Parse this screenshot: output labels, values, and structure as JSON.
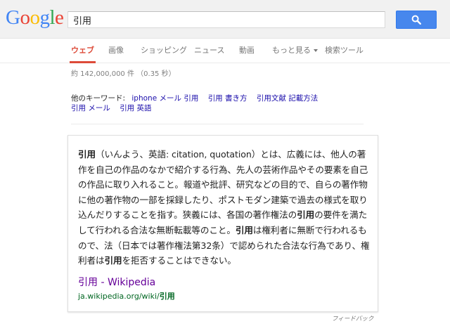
{
  "logo": {
    "text": "Google",
    "letters": [
      "G",
      "o",
      "o",
      "g",
      "l",
      "e"
    ],
    "colors": [
      "#4285f4",
      "#ea4335",
      "#fbbc05",
      "#4285f4",
      "#34a853",
      "#ea4335"
    ]
  },
  "search": {
    "query": "引用",
    "button_icon": "search-icon"
  },
  "tabs": [
    {
      "label": "ウェブ",
      "active": true
    },
    {
      "label": "画像"
    },
    {
      "label": "ショッピング"
    },
    {
      "label": "ニュース"
    },
    {
      "label": "動画"
    },
    {
      "label": "もっと見る"
    },
    {
      "label": "検索ツール"
    }
  ],
  "stats": "約 142,000,000 件 （0.35 秒）",
  "related": {
    "label": "他のキーワード:",
    "items": [
      "iphone メール 引用",
      "引用 書き方",
      "引用文献 記載方法",
      "引用 メール",
      "引用 英語"
    ]
  },
  "card": {
    "segments": [
      {
        "text": "引用",
        "bold": true
      },
      {
        "text": "（いんよう、英語: citation, quotation）とは、広義には、他人の著作を自己の作品のなかで紹介する行為、先人の芸術作品やその要素を自己の作品に取り入れること。報道や批評、研究などの目的で、自らの著作物に他の著作物の一部を採録したり、ポストモダン建築で過去の様式を取り込んだりすることを指す。狭義には、各国の著作権法の"
      },
      {
        "text": "引用",
        "bold": true
      },
      {
        "text": "の要件を満たして行われる合法な無断転載等のこと。"
      },
      {
        "text": "引用",
        "bold": true
      },
      {
        "text": "は権利者に無断で行われるもので、法（日本では著作権法第32条）で認められた合法な行為であり、権利者は"
      },
      {
        "text": "引用",
        "bold": true
      },
      {
        "text": "を拒否することはできない。"
      }
    ],
    "link_title": "引用 - Wikipedia",
    "url_prefix": "ja.wikipedia.org/wiki/",
    "url_bold": "引用"
  },
  "feedback": "フィードバック"
}
